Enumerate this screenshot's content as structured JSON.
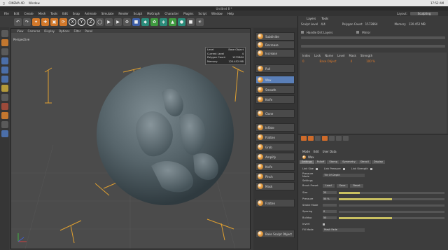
{
  "mac_menubar": {
    "items": [
      "CINEMA 4D",
      "Window"
    ],
    "time": "17:52 AM"
  },
  "window": {
    "title": "Untitled 8 *"
  },
  "app_menu": {
    "items": [
      "File",
      "Edit",
      "Create",
      "Mesh",
      "Tools",
      "Edit",
      "Snap",
      "Animate",
      "Simulate",
      "Render",
      "Sculpt",
      "MoGraph",
      "Character",
      "Plugins",
      "Script",
      "Window",
      "Help"
    ],
    "layout_label": "Layout:",
    "layout_value": "Sculpting"
  },
  "toolbar": {
    "axis_labels": [
      "X",
      "Y",
      "Z"
    ]
  },
  "viewport": {
    "menu": [
      "View",
      "Cameras",
      "Display",
      "Options",
      "Filter",
      "Panel"
    ],
    "label": "Perspective",
    "info_rows": [
      {
        "k": "Level",
        "v": "Base Object"
      },
      {
        "k": "Current Level",
        "v": "4"
      },
      {
        "k": "Polygon Count",
        "v": "1572864"
      },
      {
        "k": "Memory",
        "v": "120.452 MB"
      }
    ]
  },
  "sculpt_buttons": {
    "top": [
      "Subdivide",
      "Decrease",
      "Increase"
    ],
    "brushes": [
      "Pull",
      "Wax",
      "Smooth",
      "Knife",
      "Clone",
      "Inflate",
      "Flatten",
      "Grab",
      "Amplify",
      "Knife",
      "Pinch",
      "Mask"
    ],
    "extra": [
      "Flatten",
      "Bake Sculpt Object"
    ]
  },
  "right_panel": {
    "tabs": [
      "Layers",
      "Tools"
    ],
    "rows": [
      {
        "label": "Sculpt Level",
        "value": "4/4"
      },
      {
        "label": "Polygon Count",
        "value": "1572864"
      },
      {
        "label": "Memory",
        "value": "120.452 MB"
      }
    ],
    "handle_label": "Handle Dirt Layers",
    "mirror_label": "Mirror",
    "list_header": [
      "Index",
      "Lock",
      "Name",
      "Level",
      "Mask",
      "Strength"
    ],
    "list_row": {
      "index": "0",
      "name": "Base Object",
      "level": "4",
      "strength": "100 %"
    }
  },
  "attributes": {
    "menu": [
      "Mode",
      "Edit",
      "User Data"
    ],
    "object": "Wax",
    "tabs": [
      "Settings",
      "Falloff",
      "Stamp",
      "Symmetry",
      "Stencil",
      "Display"
    ],
    "rows_top": [
      {
        "label": "Link Size",
        "checked": true
      },
      {
        "label": "Link Pressure",
        "checked": true
      },
      {
        "label": "Link Strength",
        "checked": true
      },
      {
        "label": "Pressure Mode",
        "value": "Tilt Of Depth"
      }
    ],
    "preset_label": "Brush Preset",
    "preset_buttons": [
      "Load",
      "Save",
      "Reset"
    ],
    "settings_label": "Settings",
    "params": [
      {
        "label": "Size",
        "value": "20",
        "fraction": 0.2
      },
      {
        "label": "Pressure",
        "value": "50 %",
        "fraction": 0.5
      },
      {
        "label": "Stroke Mode",
        "value": "",
        "fraction": 0
      },
      {
        "label": "Spacing",
        "value": "0",
        "fraction": 0
      },
      {
        "label": "Buildup",
        "value": "50",
        "fraction": 0.5
      }
    ],
    "invert_label": "Invert",
    "fill_mode_label": "Fill Mode",
    "fill_mode_value": "Mask Fade"
  }
}
